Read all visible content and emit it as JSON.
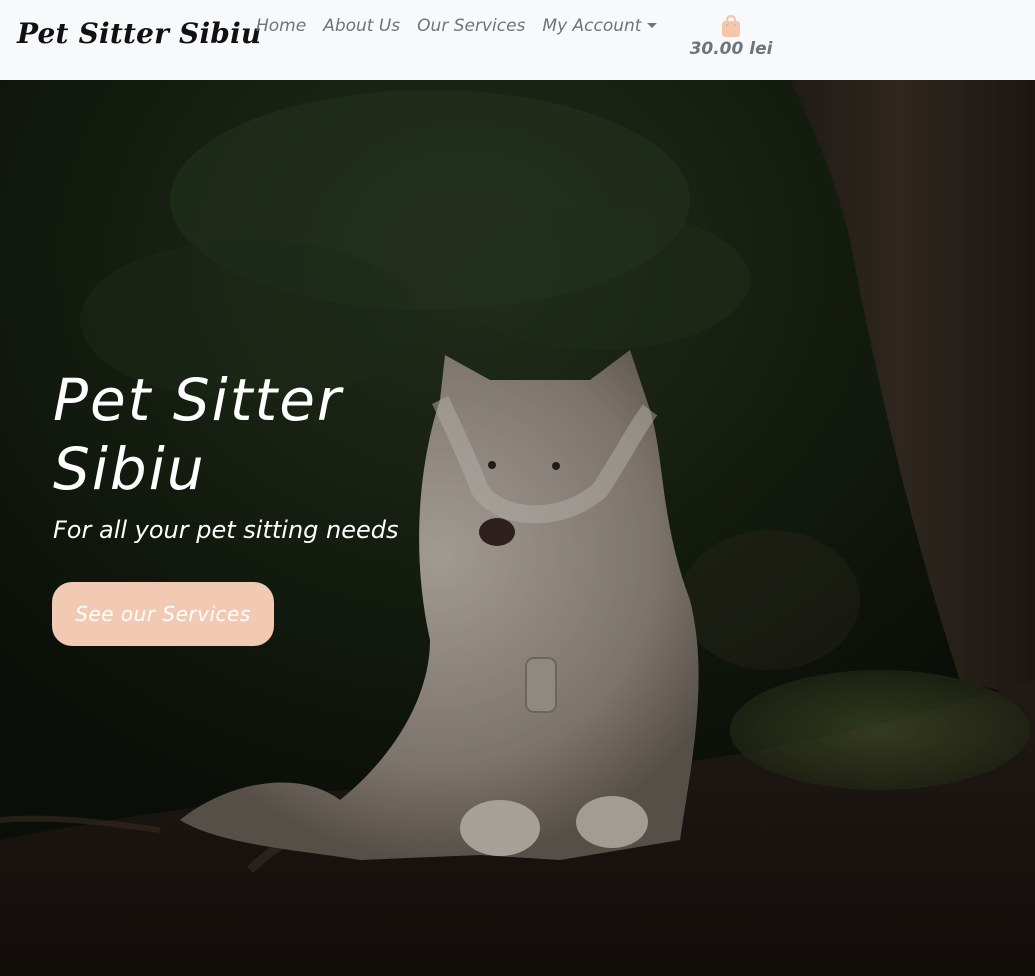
{
  "navbar": {
    "brand": "Pet Sitter Sibiu",
    "links": [
      "Home",
      "About Us",
      "Our Services",
      "My Account"
    ],
    "account_has_dropdown": true,
    "cart_icon": "shopping-bag-icon",
    "cart_total": "30.00 lei",
    "cart_icon_color": "#f4c7ab",
    "link_color": "#6c757d",
    "background": "#f8f9fa"
  },
  "hero": {
    "title": "Pet Sitter Sibiu",
    "subtitle": "For all your pet sitting needs",
    "cta_label": "See our Services",
    "cta_color": "#f2c9b2"
  }
}
